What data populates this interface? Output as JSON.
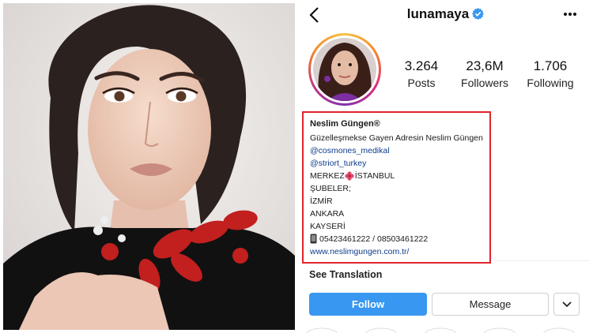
{
  "profile": {
    "username": "lunamaya",
    "verified": true,
    "stats": [
      {
        "value": "3.264",
        "label": "Posts"
      },
      {
        "value": "23,6M",
        "label": "Followers"
      },
      {
        "value": "1.706",
        "label": "Following"
      }
    ]
  },
  "bio": {
    "name": "Neslim Güngen®",
    "lines": [
      "Güzelleşmekse Gayen Adresin Neslim Güngen",
      "@cosmones_medikal",
      "@striort_turkey",
      "MERKEZ İSTANBUL",
      "ŞUBELER;",
      "İZMİR",
      "ANKARA",
      "KAYSERİ",
      "05423461222 / 08503461222",
      "www.neslimgungen.com.tr/"
    ]
  },
  "see_translation": "See Translation",
  "buttons": {
    "follow": "Follow",
    "message": "Message"
  },
  "icons": {
    "back": "chevron-left-icon",
    "verified": "verified-badge-icon",
    "more": "more-options-icon",
    "dropdown": "chevron-down-icon",
    "flower": "flower-emoji-icon",
    "phone": "mobile-phone-emoji-icon"
  },
  "colors": {
    "follow_button": "#3897f0",
    "highlight_border": "#e0242c",
    "link": "#0d3c8a",
    "verified": "#3897f0"
  }
}
